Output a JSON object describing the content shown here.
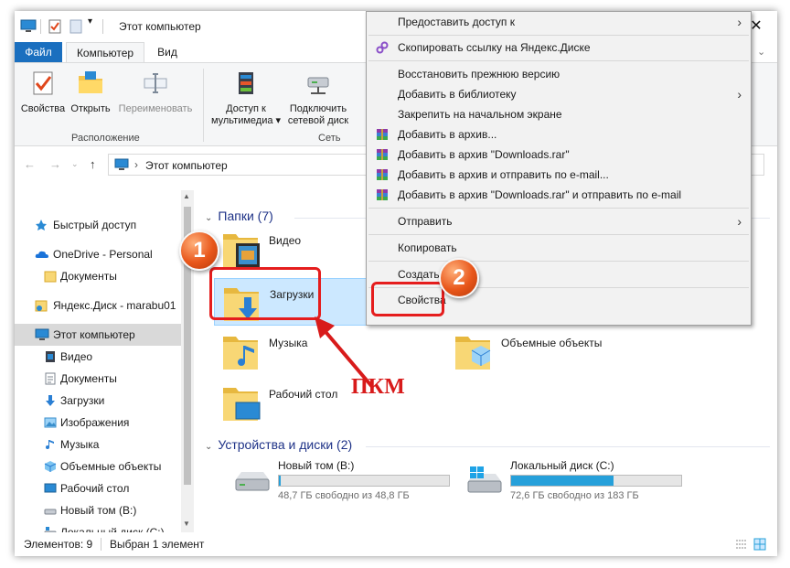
{
  "window": {
    "title": "Этот компьютер",
    "controls": {
      "close": "✕"
    }
  },
  "ribbon": {
    "tabs": [
      {
        "label": "Файл"
      },
      {
        "label": "Компьютер"
      },
      {
        "label": "Вид"
      }
    ],
    "buttons": {
      "properties": "Свойства",
      "open": "Открыть",
      "rename": "Переименовать",
      "media_access_1": "Доступ к",
      "media_access_2": "мультимедиа ▾",
      "network_drive_1": "Подключить",
      "network_drive_2": "сетевой диск"
    },
    "groups": {
      "location": "Расположение",
      "network": "Сеть"
    }
  },
  "address": {
    "path": "Этот компьютер",
    "separator": "›"
  },
  "sidebar": {
    "items": [
      {
        "label": "Быстрый доступ"
      },
      {
        "label": "OneDrive - Personal"
      },
      {
        "label": "Документы"
      },
      {
        "label": "Яндекс.Диск - marabu01"
      },
      {
        "label": "Этот компьютер"
      },
      {
        "label": "Видео"
      },
      {
        "label": "Документы"
      },
      {
        "label": "Загрузки"
      },
      {
        "label": "Изображения"
      },
      {
        "label": "Музыка"
      },
      {
        "label": "Объемные объекты"
      },
      {
        "label": "Рабочий стол"
      },
      {
        "label": "Новый том (B:)"
      },
      {
        "label": "Локальный диск (C:)"
      }
    ]
  },
  "content": {
    "folders_header": "Папки (7)",
    "folders": [
      {
        "label": "Видео"
      },
      {
        "label": "Загрузки"
      },
      {
        "label": "Музыка"
      },
      {
        "label": "Объемные объекты"
      },
      {
        "label": "Рабочий стол"
      }
    ],
    "drives_header": "Устройства и диски (2)",
    "drives": [
      {
        "name": "Новый том (B:)",
        "free": "48,7 ГБ свободно из 48,8 ГБ",
        "used_fraction": 0.002
      },
      {
        "name": "Локальный диск (C:)",
        "free": "72,6 ГБ свободно из 183 ГБ",
        "used_fraction": 0.6
      }
    ]
  },
  "context_menu": {
    "items": [
      {
        "label": "Предоставить доступ к",
        "submenu": "›"
      },
      {
        "label": "Скопировать ссылку на Яндекс.Диске"
      },
      {
        "label": "Восстановить прежнюю версию"
      },
      {
        "label": "Добавить в библиотеку",
        "submenu": "›"
      },
      {
        "label": "Закрепить на начальном экране"
      },
      {
        "label": "Добавить в архив..."
      },
      {
        "label": "Добавить в архив \"Downloads.rar\""
      },
      {
        "label": "Добавить в архив и отправить по e-mail..."
      },
      {
        "label": "Добавить в архив \"Downloads.rar\" и отправить по e-mail"
      },
      {
        "label": "Отправить",
        "submenu": "›"
      },
      {
        "label": "Копировать"
      },
      {
        "label": "Создать ярлык"
      },
      {
        "label": "Свойства"
      }
    ]
  },
  "status": {
    "count": "Элементов: 9",
    "selected": "Выбран 1 элемент"
  },
  "annotations": {
    "badge1": "1",
    "badge2": "2",
    "pkm": "ПКМ",
    "highlight_color": "#e51d1d"
  },
  "colors": {
    "accent": "#1a6fbf",
    "selection": "#cce8ff",
    "drive_fill": "#26a0da"
  }
}
